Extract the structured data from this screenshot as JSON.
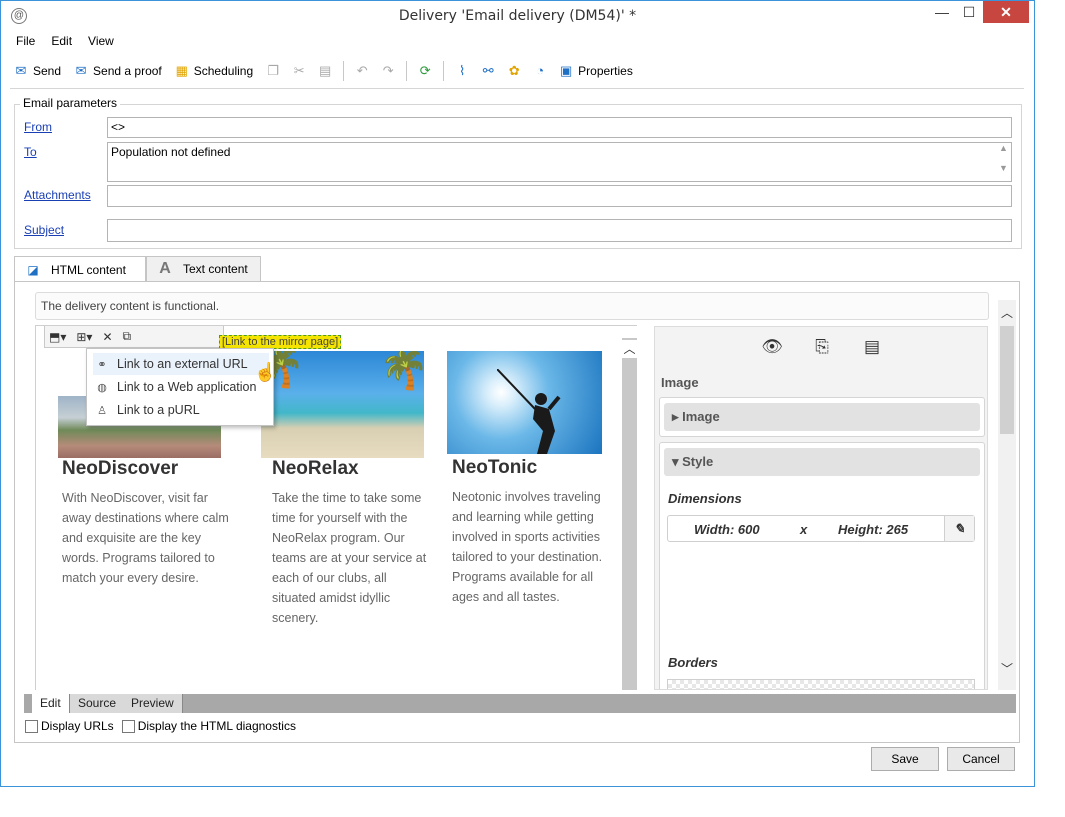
{
  "window": {
    "title": "Delivery 'Email delivery (DM54)' *",
    "min_label": "—",
    "max_label": "☐",
    "close_label": "✕"
  },
  "menu": [
    "File",
    "Edit",
    "View"
  ],
  "toolbar": {
    "send": "Send",
    "send_proof": "Send a proof",
    "scheduling": "Scheduling",
    "properties": "Properties"
  },
  "params": {
    "title": "Email parameters",
    "from_label": "From",
    "from_value": "<>",
    "to_label": "To",
    "to_value": "Population not defined",
    "attachments_label": "Attachments",
    "attachments_value": "",
    "subject_label": "Subject",
    "subject_value": ""
  },
  "tabs": {
    "html": "HTML content",
    "text": "Text content",
    "text_icon": "A"
  },
  "status_message": "The delivery content is functional.",
  "mirror_link": "[Link to the mirror page]",
  "dropdown": {
    "items": [
      {
        "label": "Link to an external URL",
        "icon": "url-link-icon"
      },
      {
        "label": "Link to a Web application",
        "icon": "web-app-link-icon"
      },
      {
        "label": "Link to a pURL",
        "icon": "purl-link-icon"
      }
    ]
  },
  "cards": [
    {
      "title": "NeoDiscover",
      "text": "With NeoDiscover, visit far away destinations where calm and exquisite are the key words. Programs tailored to match your every desire."
    },
    {
      "title": "NeoRelax",
      "text": "Take the time to take some time for yourself with the NeoRelax program. Our teams are at your service at each of our clubs, all situated amidst idyllic scenery."
    },
    {
      "title": "NeoTonic",
      "text": "Neotonic involves traveling and learning while getting involved in sports activities tailored to your destination. Programs available for all ages and all tastes."
    }
  ],
  "side_panel": {
    "heading": "Image",
    "image_section": "Image",
    "style_section": "Style",
    "dimensions_label": "Dimensions",
    "width_text": "Width: 600",
    "x_sep": "x",
    "height_text": "Height: 265",
    "borders_label": "Borders"
  },
  "bottom_tabs": [
    "Edit",
    "Source",
    "Preview"
  ],
  "checkboxes": {
    "display_urls": "Display URLs",
    "html_diagnostics": "Display the HTML diagnostics"
  },
  "buttons": {
    "save": "Save",
    "cancel": "Cancel"
  },
  "colors": {
    "window_border": "#3b94d9",
    "close_button": "#c7463f",
    "link": "#1a3fb5",
    "mirror_highlight": "#f5e400"
  }
}
